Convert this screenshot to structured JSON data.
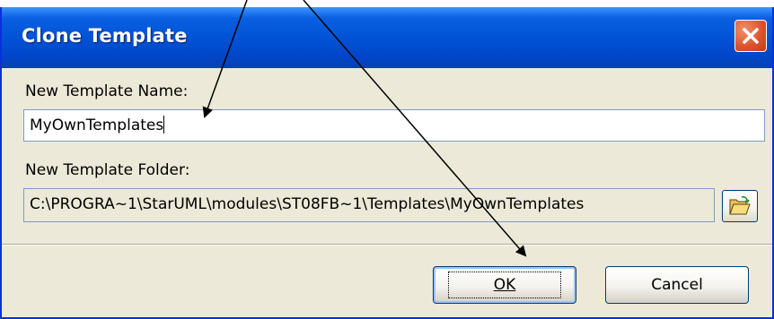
{
  "dialog": {
    "title": "Clone Template"
  },
  "fields": {
    "name_label": "New Template Name:",
    "name_value": "MyOwnTemplates",
    "folder_label": "New Template Folder:",
    "folder_value": "C:\\PROGRA~1\\StarUML\\modules\\ST08FB~1\\Templates\\MyOwnTemplates"
  },
  "buttons": {
    "ok_label": "OK",
    "cancel_label": "Cancel"
  },
  "icons": {
    "close": "close-icon",
    "browse": "folder-open-icon"
  },
  "colors": {
    "title_bar": "#0255d8",
    "close_button": "#e0542c",
    "dialog_background": "#ece9d8",
    "input_border": "#7f9db9"
  }
}
